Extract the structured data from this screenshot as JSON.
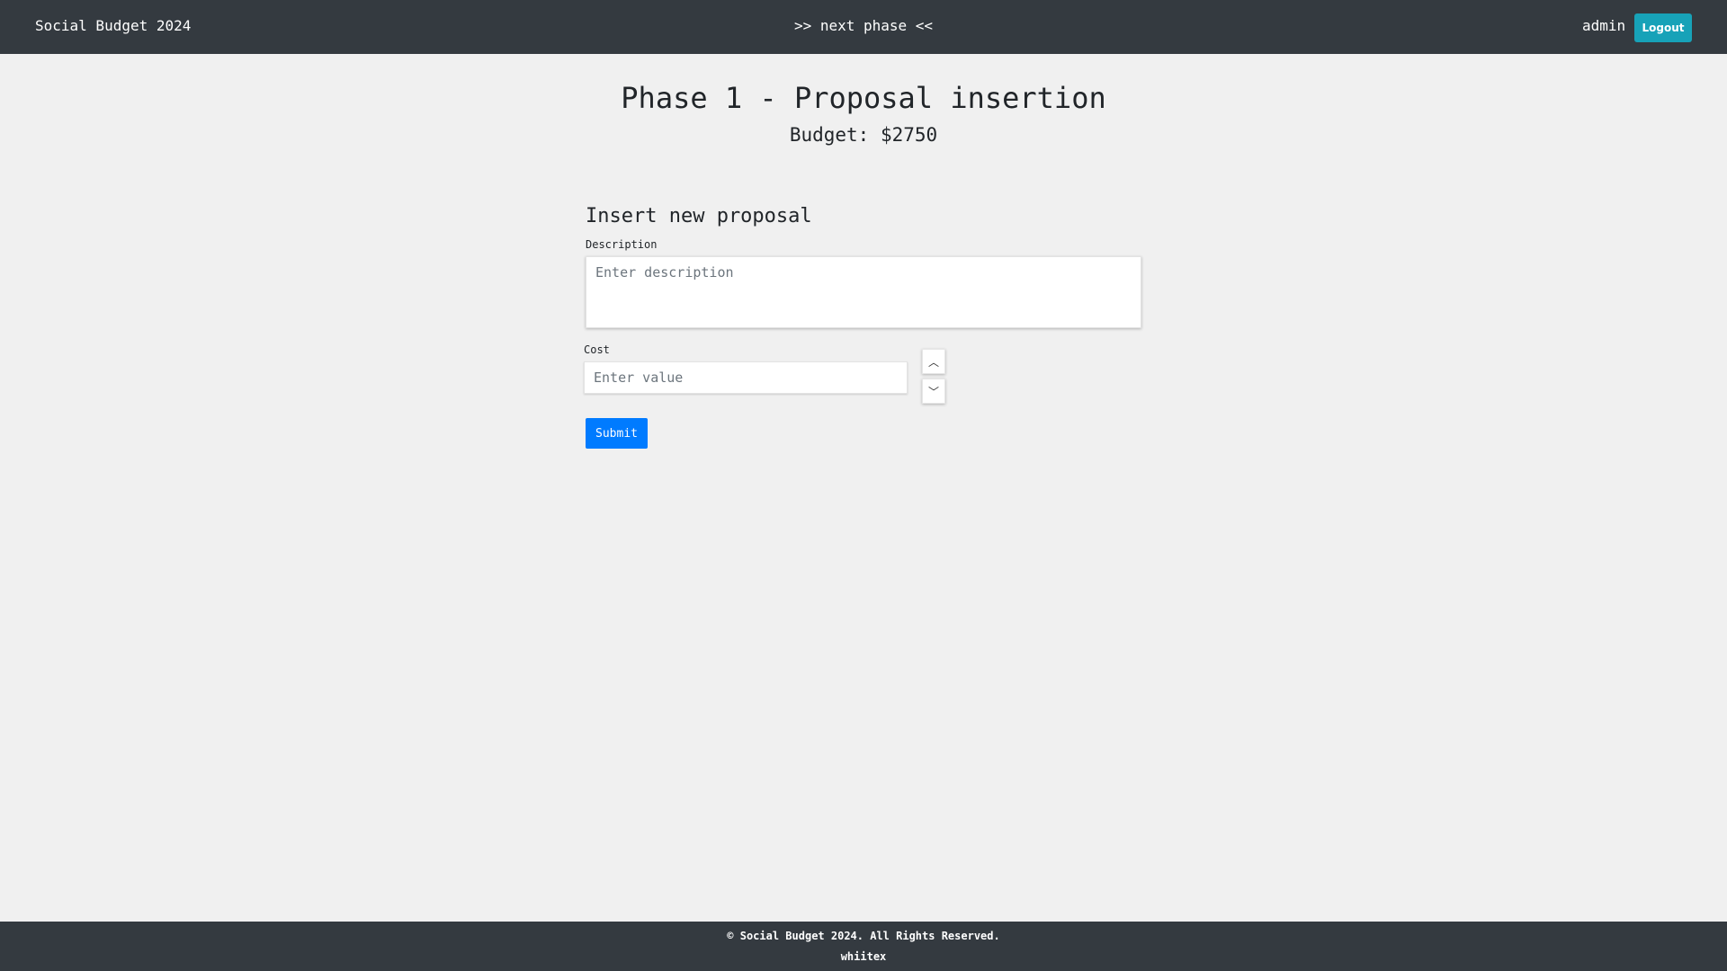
{
  "navbar": {
    "brand": "Social Budget 2024",
    "next_phase": ">> next phase <<",
    "username": "admin",
    "logout_label": "Logout"
  },
  "main": {
    "title": "Phase 1 - Proposal insertion",
    "budget": "Budget: $2750"
  },
  "form": {
    "title": "Insert new proposal",
    "description_label": "Description",
    "description_placeholder": "Enter description",
    "description_value": "",
    "cost_label": "Cost",
    "cost_placeholder": "Enter value",
    "cost_value": "",
    "stepper_up_icon": "︿",
    "stepper_down_icon": "﹀",
    "submit_label": "Submit"
  },
  "footer": {
    "copyright": "© Social Budget 2024. All Rights Reserved.",
    "author": "whiitex"
  },
  "colors": {
    "navbar_bg": "#343a40",
    "page_bg": "#f0f0f0",
    "logout_bg": "#17a2b8",
    "submit_bg": "#007bff"
  }
}
